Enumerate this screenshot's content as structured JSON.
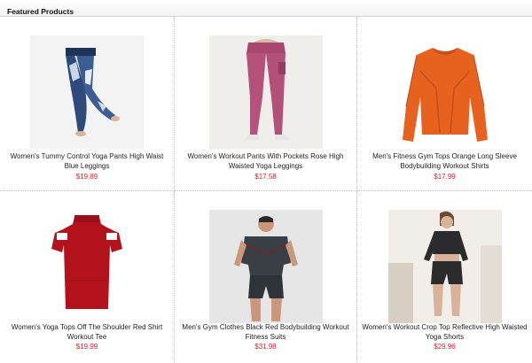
{
  "section": {
    "title": "Featured Products"
  },
  "products": [
    {
      "name": "Women's Tummy Control Yoga Pants High Waist Blue Leggings",
      "price": "$19.89",
      "image": "blue-tie-dye-leggings"
    },
    {
      "name": "Women's Workout Pants With Pockets Rose High Waisted Yoga Leggings",
      "price": "$17.58",
      "image": "rose-leggings"
    },
    {
      "name": "Men's Fitness Gym Tops Orange Long Sleeve Bodybuilding Workout Shirts",
      "price": "$17.99",
      "image": "orange-long-sleeve-shirt"
    },
    {
      "name": "Women's Yoga Tops Off The Shoulder Red Shirt Workout Tee",
      "price": "$19.99",
      "image": "red-off-shoulder-tee"
    },
    {
      "name": "Men's Gym Clothes Black Red Bodybuilding Workout Fitness Suits",
      "price": "$31.98",
      "image": "black-gym-suit"
    },
    {
      "name": "Women's Workout Crop Top Reflective High Waisted Yoga Shorts",
      "price": "$29.96",
      "image": "crop-top-shorts-set"
    }
  ],
  "colors": {
    "price": "#d8232a",
    "orange": "#e8621f",
    "red": "#b3121c",
    "rose": "#b5527a",
    "blue": "#2a3f6b"
  }
}
